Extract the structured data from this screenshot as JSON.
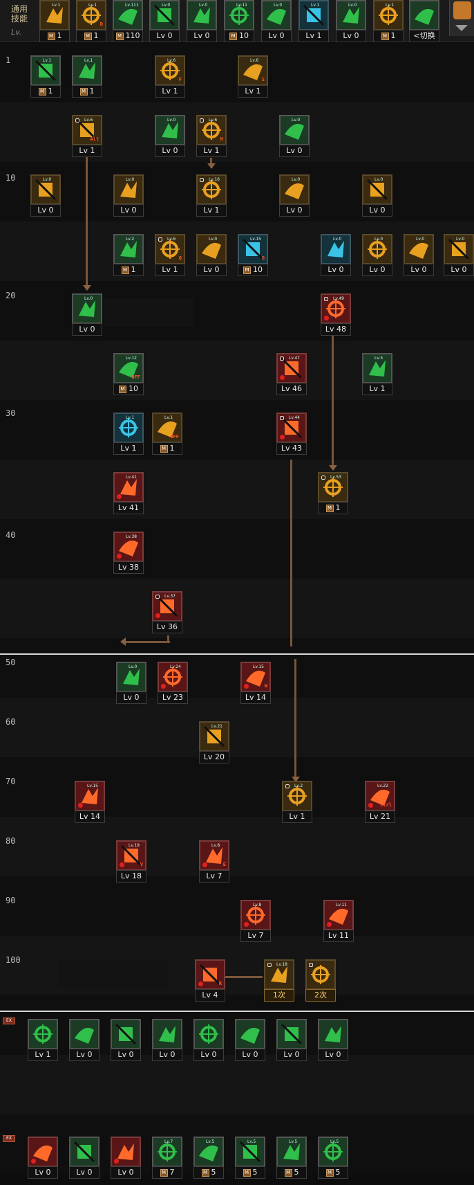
{
  "header": {
    "label": "通用\n技能",
    "lv_tag": "Lv."
  },
  "rows": [
    "1",
    "10",
    "20",
    "30",
    "40",
    "50",
    "60",
    "70",
    "80",
    "90",
    "100"
  ],
  "tabs": [
    "EX",
    "EX"
  ],
  "common": [
    {
      "icon": "fist-icon",
      "top": "Lv.1",
      "lv": "1",
      "m": true,
      "color": "y"
    },
    {
      "icon": "jump-icon",
      "top": "Lv.1",
      "lv": "1",
      "m": true,
      "color": "y",
      "sub": "D"
    },
    {
      "icon": "runner-icon",
      "top": "Lv.111",
      "lv": "110",
      "m": true,
      "color": "g"
    },
    {
      "icon": "wings-icon",
      "top": "Lv.0",
      "lv": "Lv 0",
      "color": "g"
    },
    {
      "icon": "kick-icon",
      "top": "Lv.0",
      "lv": "Lv 0",
      "color": "g"
    },
    {
      "icon": "crosshair-icon",
      "top": "Lv.11",
      "lv": "10",
      "m": true,
      "color": "g"
    },
    {
      "icon": "sprint-icon",
      "top": "Lv.0",
      "lv": "Lv 0",
      "color": "g"
    },
    {
      "icon": "target-eye-icon",
      "top": "Lv.1",
      "lv": "Lv 1",
      "color": "c"
    },
    {
      "icon": "stance-icon",
      "top": "Lv.0",
      "lv": "Lv 0",
      "color": "g"
    },
    {
      "icon": "flame-body-icon",
      "top": "Lv.1",
      "lv": "1",
      "m": true,
      "color": "y"
    },
    {
      "icon": "swap-icon",
      "top": "",
      "lv": "<切换",
      "color": "g"
    }
  ],
  "skills": [
    {
      "id": "s1",
      "icon": "gauntlet-icon",
      "lv": "1",
      "m": true,
      "color": "g",
      "top": "Lv.1"
    },
    {
      "id": "s2",
      "icon": "robot-frame-icon",
      "lv": "1",
      "m": true,
      "color": "g",
      "top": "Lv.1"
    },
    {
      "id": "s3",
      "icon": "flame-kick-icon",
      "lv": "Lv 1",
      "color": "y",
      "top": "Lv.6",
      "sub": "F"
    },
    {
      "id": "s4",
      "icon": "jump-kick-icon",
      "lv": "Lv 1",
      "color": "y",
      "top": "Lv.6",
      "sub": "S"
    },
    {
      "id": "s5",
      "icon": "burst-icon",
      "lv": "Lv 1",
      "color": "y",
      "top": "Lv.6",
      "sub": "Alt",
      "lock": true
    },
    {
      "id": "s6",
      "icon": "leap-icon",
      "lv": "Lv 0",
      "color": "g",
      "top": "Lv.0"
    },
    {
      "id": "s7",
      "icon": "dash-icon",
      "lv": "Lv 1",
      "color": "y",
      "top": "Lv.6",
      "sub": "H",
      "lock": true
    },
    {
      "id": "s8",
      "icon": "rifle-icon",
      "lv": "Lv 0",
      "color": "g",
      "top": "Lv.0"
    },
    {
      "id": "s9",
      "icon": "explosion-icon",
      "lv": "Lv 0",
      "color": "y",
      "top": "Lv.0"
    },
    {
      "id": "s10",
      "icon": "slash-icon",
      "lv": "Lv 0",
      "color": "y",
      "top": "Lv.0"
    },
    {
      "id": "s11",
      "icon": "fist-blast-icon",
      "lv": "Lv 1",
      "color": "y",
      "top": "Lv.16",
      "lock": true
    },
    {
      "id": "s12",
      "icon": "spark-icon",
      "lv": "Lv 0",
      "color": "y",
      "top": "Lv.0"
    },
    {
      "id": "s13",
      "icon": "turret-icon",
      "lv": "Lv 0",
      "color": "y",
      "top": "Lv.0"
    },
    {
      "id": "s14",
      "icon": "circuit-icon",
      "lv": "1",
      "m": true,
      "color": "g",
      "top": "Lv.2"
    },
    {
      "id": "s15",
      "icon": "grenade-icon",
      "lv": "Lv 1",
      "color": "y",
      "top": "Lv.6",
      "sub": "Q",
      "lock": true
    },
    {
      "id": "s16",
      "icon": "star-bang-icon",
      "lv": "Lv 0",
      "color": "y",
      "top": "Lv.0"
    },
    {
      "id": "s17",
      "icon": "mech-icon",
      "lv": "10",
      "m": true,
      "color": "c",
      "top": "Lv.15",
      "sub": "G"
    },
    {
      "id": "s18",
      "icon": "drill-icon",
      "lv": "Lv 0",
      "color": "c",
      "top": "Lv.0"
    },
    {
      "id": "s19",
      "icon": "flying-kick-icon",
      "lv": "Lv 0",
      "color": "y",
      "top": "Lv.0"
    },
    {
      "id": "s20",
      "icon": "boot-icon",
      "lv": "Lv 0",
      "color": "y",
      "top": "Lv.0"
    },
    {
      "id": "s21",
      "icon": "bomb-icon",
      "lv": "Lv 0",
      "color": "y",
      "top": "Lv.0"
    },
    {
      "id": "s22",
      "icon": "upgrade-icon",
      "lv": "Lv 0",
      "color": "g",
      "top": "Lv.0"
    },
    {
      "id": "s23",
      "icon": "fire-claw-icon",
      "lv": "Lv 48",
      "color": "r",
      "top": "Lv.49",
      "lock": true
    },
    {
      "id": "s24",
      "icon": "chip-icon",
      "lv": "10",
      "m": true,
      "color": "g",
      "top": "Lv.12",
      "sub": "OFF"
    },
    {
      "id": "s25",
      "icon": "gear-blast-icon",
      "lv": "Lv 46",
      "color": "r",
      "top": "Lv.47",
      "lock": true
    },
    {
      "id": "s26",
      "icon": "cannon-icon",
      "lv": "Lv 1",
      "color": "g",
      "top": "Lv.5"
    },
    {
      "id": "s27",
      "icon": "clock-icon",
      "lv": "Lv 1",
      "color": "c",
      "top": "Lv.1"
    },
    {
      "id": "s28",
      "icon": "play-off-icon",
      "lv": "1",
      "m": true,
      "color": "y",
      "top": "Lv.1",
      "sub": "OFF"
    },
    {
      "id": "s29",
      "icon": "missile-icon",
      "lv": "Lv 43",
      "color": "r",
      "top": "Lv.44",
      "lock": true
    },
    {
      "id": "s30",
      "icon": "golem-icon",
      "lv": "Lv 41",
      "color": "r",
      "top": "Lv.41"
    },
    {
      "id": "s31",
      "icon": "sun-gear-icon",
      "lv": "1",
      "m": true,
      "color": "y",
      "top": "Lv.53",
      "lock": true
    },
    {
      "id": "s32",
      "icon": "rocket-fist-icon",
      "lv": "Lv 38",
      "color": "r",
      "top": "Lv.38"
    },
    {
      "id": "s33",
      "icon": "shell-icon",
      "lv": "Lv 36",
      "color": "r",
      "top": "Lv.37",
      "lock": true
    },
    {
      "id": "s34",
      "icon": "drone-icon",
      "lv": "Lv 0",
      "color": "g",
      "top": "Lv.0"
    },
    {
      "id": "s35",
      "icon": "bracket-c-icon",
      "lv": "Lv 23",
      "color": "r",
      "top": "Lv.24"
    },
    {
      "id": "s36",
      "icon": "bracket-w-icon",
      "lv": "Lv 14",
      "color": "r",
      "top": "Lv.15",
      "sub": "W"
    },
    {
      "id": "s37",
      "icon": "satellite-icon",
      "lv": "Lv 20",
      "color": "y",
      "top": "Lv.21"
    },
    {
      "id": "s38",
      "icon": "horned-helmet-icon",
      "lv": "Lv 14",
      "color": "r",
      "top": "Lv.15"
    },
    {
      "id": "s39",
      "icon": "cog-lock-icon",
      "lv": "Lv 1",
      "color": "y",
      "top": "Lv.2",
      "lock": true
    },
    {
      "id": "s40",
      "icon": "fire-rain-icon",
      "lv": "Lv 21",
      "color": "r",
      "top": "Lv.22",
      "sub": "Ctrl"
    },
    {
      "id": "s41",
      "icon": "flare-icon",
      "lv": "Lv 18",
      "color": "r",
      "top": "Lv.19",
      "sub": "V"
    },
    {
      "id": "s42",
      "icon": "red-robot-icon",
      "lv": "Lv 7",
      "color": "r",
      "top": "Lv.8",
      "sub": "E"
    },
    {
      "id": "s43",
      "icon": "beam-icon",
      "lv": "Lv 7",
      "color": "r",
      "top": "Lv.8"
    },
    {
      "id": "s44",
      "icon": "gatling-icon",
      "lv": "Lv 11",
      "color": "r",
      "top": "Lv.11"
    },
    {
      "id": "s45",
      "icon": "awakening-icon",
      "lv": "Lv 4",
      "color": "r",
      "top": "",
      "sub": "R"
    },
    {
      "id": "s46",
      "icon": "awaken-1-icon",
      "lv": "1次",
      "color": "y",
      "top": "Lv.18",
      "lock": true,
      "awk": true
    },
    {
      "id": "s47",
      "icon": "awaken-2-icon",
      "lv": "2次",
      "color": "y",
      "top": "",
      "lock": true,
      "awk": true
    }
  ],
  "ex1": [
    {
      "icon": "ex-leap-icon",
      "lv": "Lv 1",
      "color": "g"
    },
    {
      "icon": "ex-kick-icon",
      "lv": "Lv 0",
      "color": "g"
    },
    {
      "icon": "ex-jump-icon",
      "lv": "Lv 0",
      "color": "g"
    },
    {
      "icon": "ex-dash-icon",
      "lv": "Lv 0",
      "color": "g"
    },
    {
      "icon": "ex-rifle-icon",
      "lv": "Lv 0",
      "color": "g"
    },
    {
      "icon": "ex-mech-icon",
      "lv": "Lv 0",
      "color": "g"
    },
    {
      "icon": "ex-sword-icon",
      "lv": "Lv 0",
      "color": "g"
    },
    {
      "icon": "ex-blade-icon",
      "lv": "Lv 0",
      "color": "g"
    }
  ],
  "ex2": [
    {
      "icon": "ex-grenade-icon",
      "lv": "Lv 0",
      "color": "r"
    },
    {
      "icon": "ex-bang-icon",
      "lv": "Lv 0",
      "color": "g"
    },
    {
      "icon": "ex-fist-icon",
      "lv": "Lv 0",
      "color": "r"
    },
    {
      "icon": "ex-armor-icon",
      "lv": "7",
      "m": true,
      "color": "g",
      "top": "Lv.7"
    },
    {
      "icon": "ex-guard-icon",
      "lv": "5",
      "m": true,
      "color": "g",
      "top": "Lv.5"
    },
    {
      "icon": "ex-spear-icon",
      "lv": "5",
      "m": true,
      "color": "g",
      "top": "Lv.5"
    },
    {
      "icon": "ex-gun-icon",
      "lv": "5",
      "m": true,
      "color": "g",
      "top": "Lv.5"
    },
    {
      "icon": "ex-tank-icon",
      "lv": "5",
      "m": true,
      "color": "g",
      "top": "Lv.5"
    }
  ],
  "colors": {
    "green": "#2fbf4a",
    "yellow": "#e8a020",
    "red": "#c23030",
    "cyan": "#2aa8c8",
    "connector": "#7a5638"
  }
}
